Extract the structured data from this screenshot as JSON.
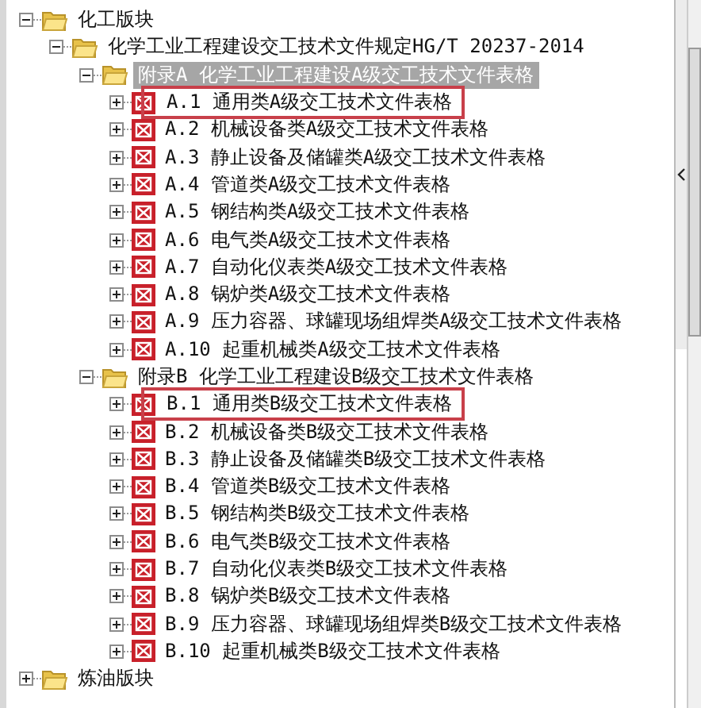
{
  "tree": [
    {
      "label": "化工版块",
      "kind": "folder",
      "expanded": true,
      "selected": false,
      "highlighted": false,
      "children": [
        {
          "label": "化学工业工程建设交工技术文件规定HG/T 20237-2014",
          "kind": "folder",
          "expanded": true,
          "selected": false,
          "highlighted": false,
          "children": [
            {
              "label": "附录A 化学工业工程建设A级交工技术文件表格",
              "kind": "folder",
              "expanded": true,
              "selected": true,
              "highlighted": false,
              "children": [
                {
                  "label": "A.1 通用类A级交工技术文件表格",
                  "kind": "sheet",
                  "expanded": false,
                  "selected": false,
                  "highlighted": true
                },
                {
                  "label": "A.2 机械设备类A级交工技术文件表格",
                  "kind": "sheet",
                  "expanded": false,
                  "selected": false,
                  "highlighted": false
                },
                {
                  "label": "A.3 静止设备及储罐类A级交工技术文件表格",
                  "kind": "sheet",
                  "expanded": false,
                  "selected": false,
                  "highlighted": false
                },
                {
                  "label": "A.4 管道类A级交工技术文件表格",
                  "kind": "sheet",
                  "expanded": false,
                  "selected": false,
                  "highlighted": false
                },
                {
                  "label": "A.5 钢结构类A级交工技术文件表格",
                  "kind": "sheet",
                  "expanded": false,
                  "selected": false,
                  "highlighted": false
                },
                {
                  "label": "A.6 电气类A级交工技术文件表格",
                  "kind": "sheet",
                  "expanded": false,
                  "selected": false,
                  "highlighted": false
                },
                {
                  "label": "A.7 自动化仪表类A级交工技术文件表格",
                  "kind": "sheet",
                  "expanded": false,
                  "selected": false,
                  "highlighted": false
                },
                {
                  "label": "A.8 锅炉类A级交工技术文件表格",
                  "kind": "sheet",
                  "expanded": false,
                  "selected": false,
                  "highlighted": false
                },
                {
                  "label": "A.9 压力容器、球罐现场组焊类A级交工技术文件表格",
                  "kind": "sheet",
                  "expanded": false,
                  "selected": false,
                  "highlighted": false
                },
                {
                  "label": "A.10 起重机械类A级交工技术文件表格",
                  "kind": "sheet",
                  "expanded": false,
                  "selected": false,
                  "highlighted": false
                }
              ]
            },
            {
              "label": "附录B 化学工业工程建设B级交工技术文件表格",
              "kind": "folder",
              "expanded": true,
              "selected": false,
              "highlighted": false,
              "children": [
                {
                  "label": "B.1 通用类B级交工技术文件表格",
                  "kind": "sheet",
                  "expanded": false,
                  "selected": false,
                  "highlighted": true
                },
                {
                  "label": "B.2 机械设备类B级交工技术文件表格",
                  "kind": "sheet",
                  "expanded": false,
                  "selected": false,
                  "highlighted": false
                },
                {
                  "label": "B.3 静止设备及储罐类B级交工技术文件表格",
                  "kind": "sheet",
                  "expanded": false,
                  "selected": false,
                  "highlighted": false
                },
                {
                  "label": "B.4 管道类B级交工技术文件表格",
                  "kind": "sheet",
                  "expanded": false,
                  "selected": false,
                  "highlighted": false
                },
                {
                  "label": "B.5 钢结构类B级交工技术文件表格",
                  "kind": "sheet",
                  "expanded": false,
                  "selected": false,
                  "highlighted": false
                },
                {
                  "label": "B.6 电气类B级交工技术文件表格",
                  "kind": "sheet",
                  "expanded": false,
                  "selected": false,
                  "highlighted": false
                },
                {
                  "label": "B.7 自动化仪表类B级交工技术文件表格",
                  "kind": "sheet",
                  "expanded": false,
                  "selected": false,
                  "highlighted": false
                },
                {
                  "label": "B.8 锅炉类B级交工技术文件表格",
                  "kind": "sheet",
                  "expanded": false,
                  "selected": false,
                  "highlighted": false
                },
                {
                  "label": "B.9 压力容器、球罐现场组焊类B级交工技术文件表格",
                  "kind": "sheet",
                  "expanded": false,
                  "selected": false,
                  "highlighted": false
                },
                {
                  "label": "B.10 起重机械类B级交工技术文件表格",
                  "kind": "sheet",
                  "expanded": false,
                  "selected": false,
                  "highlighted": false
                }
              ]
            }
          ]
        }
      ]
    },
    {
      "label": "炼油版块",
      "kind": "folder",
      "expanded": false,
      "selected": false,
      "highlighted": false
    }
  ]
}
